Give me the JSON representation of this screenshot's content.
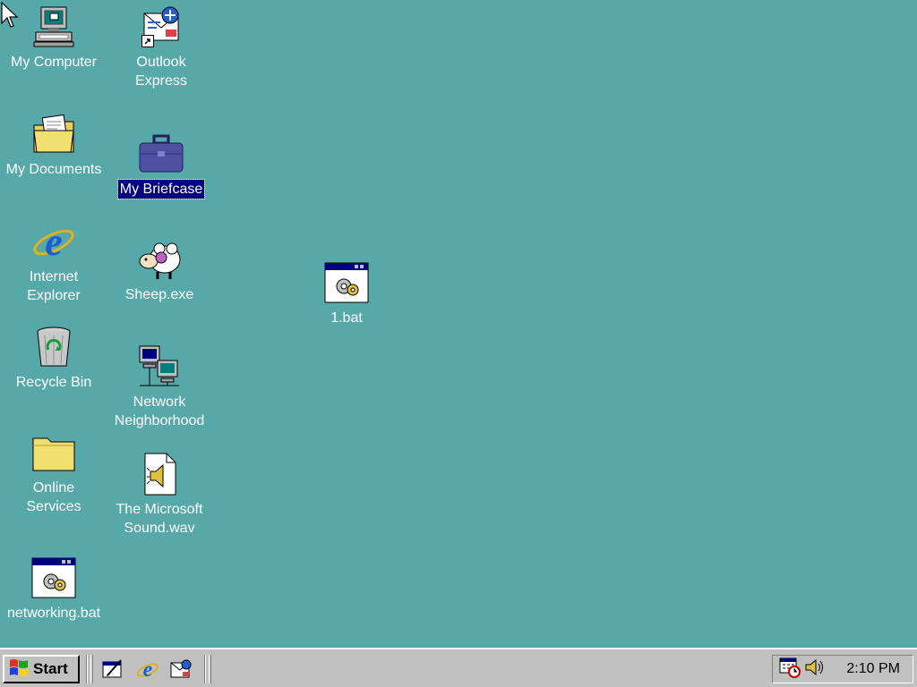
{
  "desktop": {
    "icons": [
      {
        "label": "My Computer",
        "icon": "my-computer-icon"
      },
      {
        "label": "Outlook\nExpress",
        "icon": "outlook-express-icon"
      },
      {
        "label": "My Documents",
        "icon": "folder-documents-icon"
      },
      {
        "label": "My Briefcase",
        "icon": "briefcase-icon",
        "selected": true
      },
      {
        "label": "Internet\nExplorer",
        "icon": "internet-explorer-icon"
      },
      {
        "label": "Sheep.exe",
        "icon": "sheep-icon"
      },
      {
        "label": "Recycle Bin",
        "icon": "recycle-bin-icon"
      },
      {
        "label": "Network\nNeighborhood",
        "icon": "network-neighborhood-icon"
      },
      {
        "label": "Online\nServices",
        "icon": "folder-icon"
      },
      {
        "label": "The Microsoft\nSound.wav",
        "icon": "sound-file-icon"
      },
      {
        "label": "networking.bat",
        "icon": "batch-file-icon"
      },
      {
        "label": "1.bat",
        "icon": "batch-file-icon"
      }
    ]
  },
  "taskbar": {
    "start_label": "Start",
    "quick_launch": [
      "show-desktop-icon",
      "internet-explorer-icon",
      "outlook-express-icon"
    ],
    "tray": {
      "icons": [
        "task-scheduler-icon",
        "volume-icon"
      ],
      "clock": "2:10 PM"
    }
  },
  "colors": {
    "desktop": "#57a8a8",
    "taskbar": "#c0c0c0",
    "selection": "#000080"
  }
}
